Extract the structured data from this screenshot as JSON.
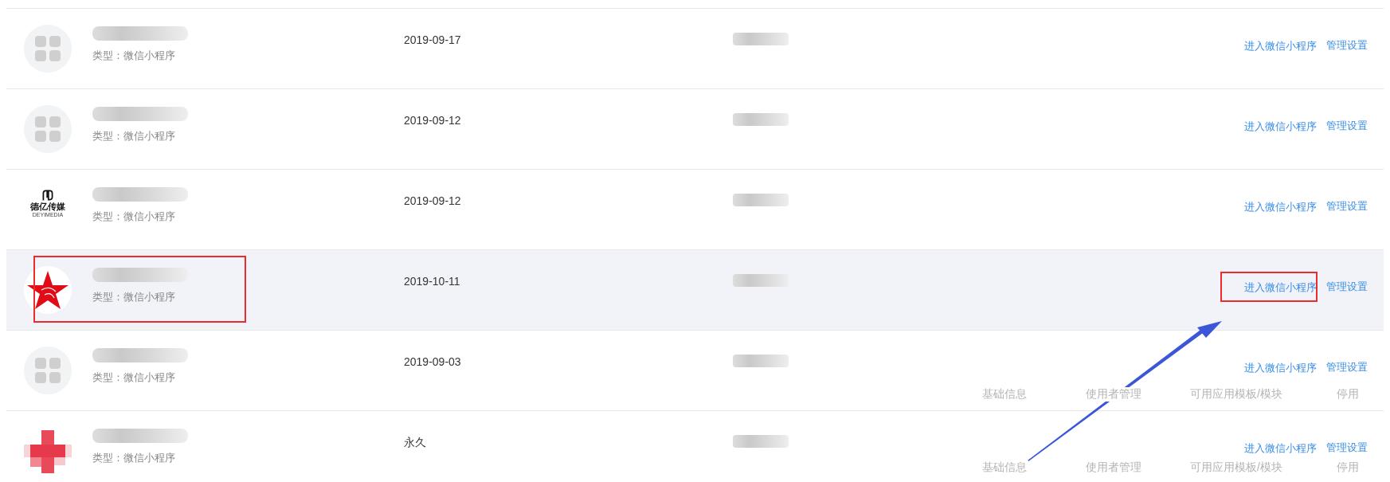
{
  "rows": [
    {
      "kind": "placeholder",
      "type": "类型：微信小程序",
      "date": "2019-09-17",
      "selected": false,
      "callout": false,
      "enter_link": "进入微信小程序",
      "manage_link": "管理设置"
    },
    {
      "kind": "placeholder",
      "type": "类型：微信小程序",
      "date": "2019-09-12",
      "selected": false,
      "callout": false,
      "enter_link": "进入微信小程序",
      "manage_link": "管理设置"
    },
    {
      "kind": "wordmark",
      "logo_text": "德亿传媒",
      "logo_subtext": "DEYIMEDIA",
      "type": "类型：微信小程序",
      "date": "2019-09-12",
      "selected": false,
      "callout": false,
      "enter_link": "进入微信小程序",
      "manage_link": "管理设置"
    },
    {
      "kind": "star",
      "type": "类型：微信小程序",
      "date": "2019-10-11",
      "selected": true,
      "callout": true,
      "enter_link": "进入微信小程序",
      "manage_link": "管理设置"
    },
    {
      "kind": "placeholder",
      "type": "类型：微信小程序",
      "date": "2019-09-03",
      "selected": false,
      "callout": false,
      "enter_link": "进入微信小程序",
      "manage_link": "管理设置"
    },
    {
      "kind": "cross",
      "type": "类型：微信小程序",
      "date": "永久",
      "selected": false,
      "callout": false,
      "enter_link": "进入微信小程序",
      "manage_link": "管理设置"
    }
  ],
  "ghost_menus": [
    [
      "基础信息",
      "使用者管理",
      "可用应用模板/模块",
      "停用"
    ],
    [
      "基础信息",
      "使用者管理",
      "可用应用模板/模块",
      "停用"
    ]
  ]
}
